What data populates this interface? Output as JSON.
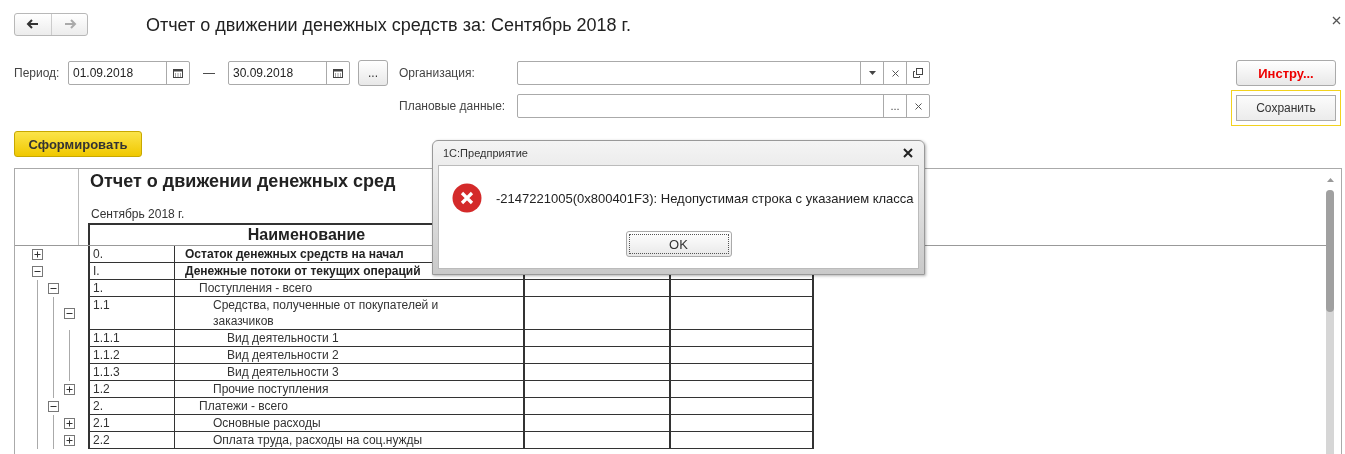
{
  "window": {
    "title": "Отчет о движении денежных средств за: Сентябрь 2018 г."
  },
  "nav": [
    {
      "kind": "back",
      "disabled": false
    },
    {
      "kind": "forward",
      "disabled": true
    }
  ],
  "period": {
    "label": "Период:",
    "from": "01.09.2018",
    "separator": "—",
    "to": "30.09.2018",
    "more_button": "..."
  },
  "organization": {
    "label": "Организация:"
  },
  "plan_data": {
    "label": "Плановые данные:",
    "more_button": "..."
  },
  "buttons": [
    {
      "label": "Инстру...",
      "kind": "warning",
      "focused": false
    },
    {
      "label": "Сохранить",
      "kind": "default",
      "focused": true
    }
  ],
  "generate_button": {
    "label": "Сформировать"
  },
  "report": {
    "title": "Отчет о движении денежных сред",
    "period": "Сентябрь 2018 г.",
    "header": "Наименование",
    "rows": [
      {
        "number": "0.",
        "name": "Остаток денежных средств на начал",
        "bold": true,
        "expanded": false
      },
      {
        "number": "I.",
        "name": "Денежные потоки от текущих операций",
        "bold": true,
        "expanded": true,
        "children": [
          {
            "number": "1.",
            "name": "Поступления - всего",
            "bold": false,
            "expanded": true,
            "children": [
              {
                "number": "1.1",
                "name": "Средства, полученные от покупателей и заказчиков",
                "bold": false,
                "expanded": true,
                "children": [
                  {
                    "number": "1.1.1",
                    "name": "Вид деятельности 1",
                    "bold": false
                  },
                  {
                    "number": "1.1.2",
                    "name": "Вид деятельности 2",
                    "bold": false
                  },
                  {
                    "number": "1.1.3",
                    "name": "Вид деятельности 3",
                    "bold": false
                  }
                ]
              },
              {
                "number": "1.2",
                "name": "Прочие поступления",
                "bold": false,
                "expanded": false
              }
            ]
          },
          {
            "number": "2.",
            "name": "Платежи - всего",
            "bold": false,
            "expanded": true,
            "children": [
              {
                "number": "2.1",
                "name": "Основные расходы",
                "bold": false,
                "expanded": false
              },
              {
                "number": "2.2",
                "name": "Оплата труда, расходы на соц.нужды",
                "bold": false,
                "expanded": false
              }
            ]
          }
        ]
      }
    ]
  },
  "dialog": {
    "title": "1С:Предприятие",
    "kind": "error",
    "message": "-2147221005(0x800401F3): Недопустимая строка с указанием класса",
    "button": "OK"
  }
}
